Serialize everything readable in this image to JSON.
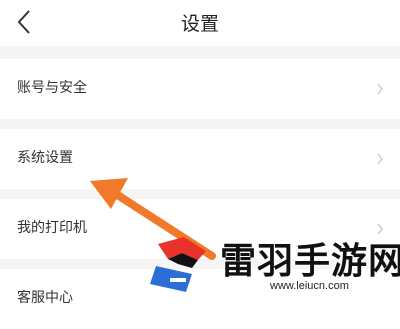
{
  "header": {
    "title": "设置"
  },
  "menu": {
    "items": [
      {
        "label": "账号与安全"
      },
      {
        "label": "系统设置"
      },
      {
        "label": "我的打印机"
      },
      {
        "label": "客服中心"
      }
    ]
  },
  "annotation": {
    "arrow_color": "#f07a2a"
  },
  "watermark": {
    "title": "雷羽手游网",
    "url": "www.leiucn.com",
    "logo_colors": [
      "#e8322b",
      "#2b6fd6",
      "#111111"
    ]
  }
}
